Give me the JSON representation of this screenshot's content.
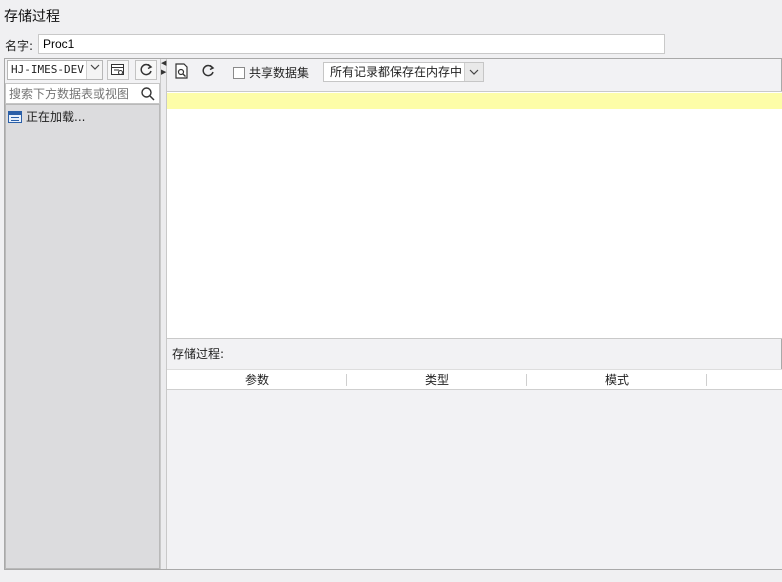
{
  "window": {
    "title": "存储过程"
  },
  "name_field": {
    "label": "名字:",
    "value": "Proc1"
  },
  "left_pane": {
    "connection": "HJ-IMES-DEV",
    "search_placeholder": "搜索下方数据表或视图",
    "tree_item": "正在加载..."
  },
  "toolbar": {
    "share_label": "共享数据集",
    "share_checked": false,
    "storage_mode": "所有记录都保存在内存中"
  },
  "bottom": {
    "section_label": "存储过程:",
    "columns": [
      "参数",
      "类型",
      "模式"
    ]
  },
  "icons": {
    "left_toolbar": [
      "chevron-down-icon",
      "preview-table-icon",
      "refresh-icon"
    ],
    "right_toolbar": [
      "preview-icon",
      "refresh-icon"
    ],
    "search": "search-icon"
  },
  "colors": {
    "highlight_line": "#fdfda8",
    "tree_background": "#dcdcde"
  }
}
